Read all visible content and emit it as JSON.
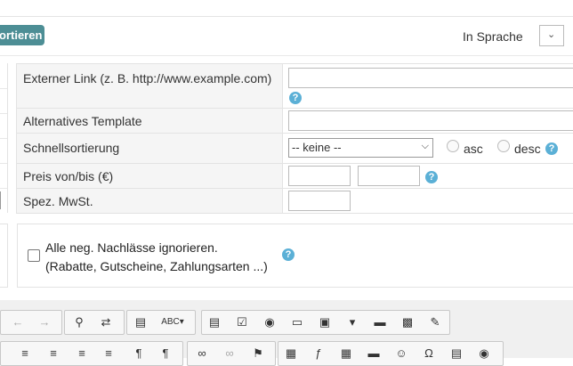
{
  "header": {
    "sort_button_label": "ortieren",
    "language_label": "In Sprache",
    "language_select_value": ""
  },
  "form": {
    "rows": [
      {
        "label": "Externer Link (z. B. http://www.example.com)"
      },
      {
        "label": "Alternatives Template"
      },
      {
        "label": "Schnellsortierung"
      },
      {
        "label": "Preis von/bis (€)"
      },
      {
        "label": "Spez. MwSt."
      }
    ],
    "quick_sort": {
      "selected": "-- keine --",
      "asc_label": "asc",
      "desc_label": "desc"
    },
    "ignore_discounts": {
      "line1": "Alle neg. Nachlässe ignorieren.",
      "line2": "(Rabatte, Gutscheine, Zahlungsarten ...)",
      "checked": false
    }
  },
  "help_glyph": "?",
  "toolbar": {
    "row1": {
      "group1": [
        "undo-icon",
        "redo-icon"
      ],
      "group2": [
        "find-icon",
        "replace-icon"
      ],
      "group3": [
        "template-icon",
        "spellcheck-icon"
      ],
      "group4": [
        "form-icon",
        "checkbox-icon",
        "radio-icon",
        "textfield-icon",
        "textarea-icon",
        "select-icon",
        "button-icon",
        "imagebutton-icon",
        "hiddenfield-icon"
      ]
    },
    "row2": {
      "group1": [
        "align-left-icon",
        "align-center-icon",
        "align-right-icon",
        "justify-icon",
        "ltr-icon",
        "rtl-icon"
      ],
      "group2": [
        "link-icon",
        "unlink-icon",
        "anchor-icon"
      ],
      "group3": [
        "image-icon",
        "flash-icon",
        "table-icon",
        "hr-icon",
        "smiley-icon",
        "specialchar-icon",
        "pagebreak-icon",
        "iframe-icon"
      ]
    }
  },
  "colors": {
    "accent": "#4d8e95",
    "help": "#5bb0d6"
  }
}
